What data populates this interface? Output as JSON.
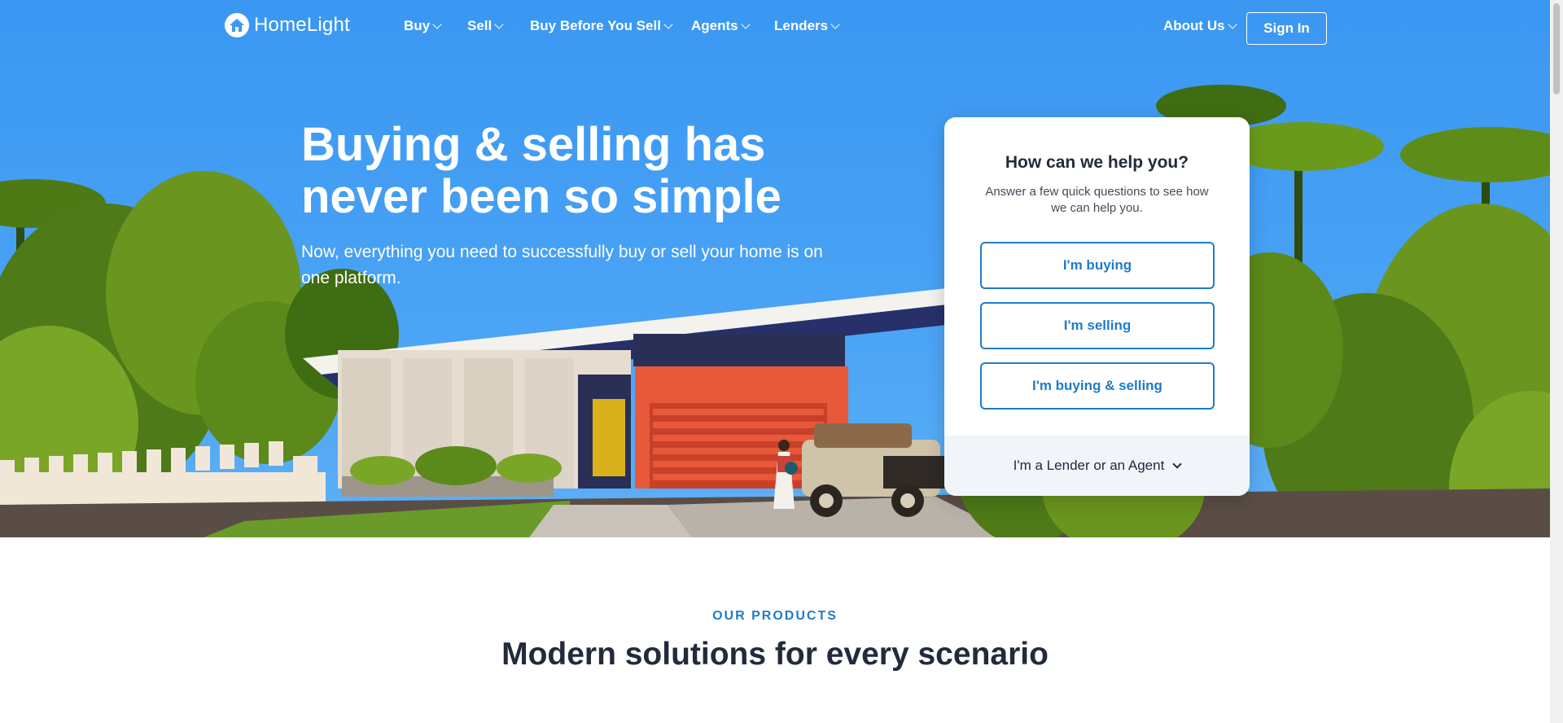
{
  "nav": {
    "logo_text": "HomeLight",
    "items": [
      {
        "label": "Buy"
      },
      {
        "label": "Sell"
      },
      {
        "label": "Buy Before You Sell"
      },
      {
        "label": "Agents"
      },
      {
        "label": "Lenders"
      }
    ],
    "about_label": "About Us",
    "signin_label": "Sign In"
  },
  "hero": {
    "headline_line1": "Buying & selling has",
    "headline_line2": "never been so simple",
    "subhead": "Now, everything you need to successfully buy or sell your home is on one platform."
  },
  "help_card": {
    "title": "How can we help you?",
    "description": "Answer a few quick questions to see how we can help you.",
    "options": [
      {
        "label": "I'm buying"
      },
      {
        "label": "I'm selling"
      },
      {
        "label": "I'm buying & selling"
      }
    ],
    "footer_label": "I'm a Lender or an Agent"
  },
  "products": {
    "eyebrow": "OUR PRODUCTS",
    "title": "Modern solutions for every scenario"
  },
  "colors": {
    "sky": "#3a97f2",
    "accent": "#1f7bc9",
    "dark_text": "#222b3c",
    "garage": "#e8583a",
    "foliage": "#6b8f1e"
  }
}
